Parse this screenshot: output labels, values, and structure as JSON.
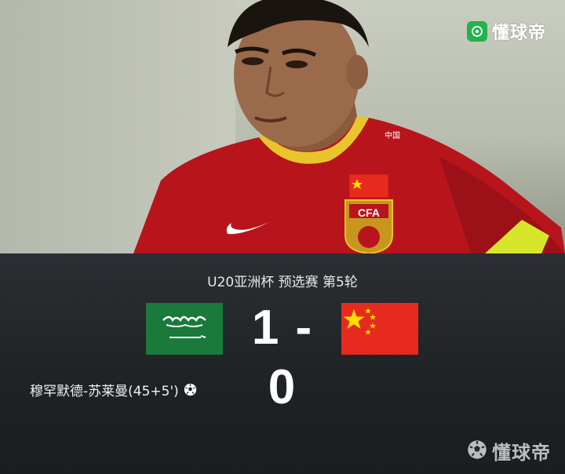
{
  "brand": {
    "name": "懂球帝",
    "accent": "#23b34a"
  },
  "match": {
    "title": "U20亚洲杯 预选赛 第5轮",
    "home_team_flag": "saudi-arabia-flag",
    "away_team_flag": "china-flag",
    "score": "1 - 0"
  },
  "events": {
    "scorer": "穆罕默德-苏莱曼(45+5')",
    "scorer_icon": "soccer-ball-icon"
  },
  "colors": {
    "saudi_green": "#1a7a3c",
    "china_red": "#e62b1e",
    "panel_bg": "#1f2225"
  }
}
